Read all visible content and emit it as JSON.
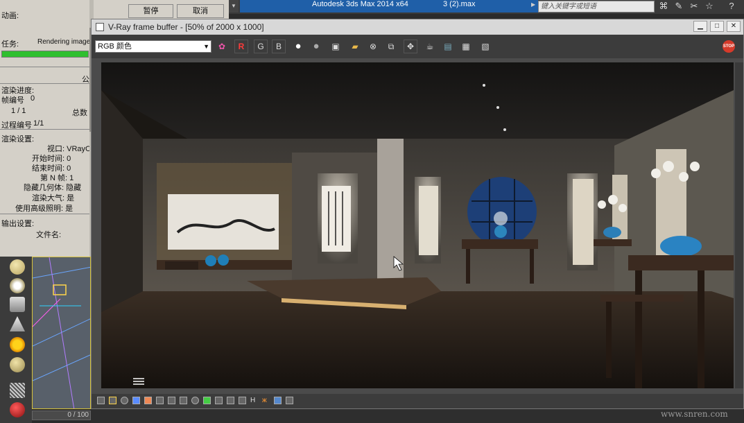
{
  "topbar": {
    "app_title": "Autodesk 3ds Max  2014 x64",
    "file_title": "3 (2).max",
    "search_placeholder": "键入关键字或短语"
  },
  "render_panel": {
    "animation_label": "动画:",
    "pause_button": "暂停",
    "cancel_button": "取消",
    "task_label": "任务:",
    "task_value": "Rendering image",
    "progress_fraction": 1.0,
    "common_tab": "公",
    "progress_heading": "渲染进度:",
    "frame_label": "帧编号",
    "frame_value": "0",
    "frame_count": "1 / 1",
    "total_label": "总数",
    "pass_label": "过程编号",
    "pass_value": "1/1",
    "settings_heading": "渲染设置:",
    "viewport_label": "视口: VRayC",
    "start_time": "开始时间: 0",
    "end_time": "结束时间: 0",
    "nth_frame": "第 N 帧: 1",
    "hidden_geo": "隐藏几何体: 隐藏",
    "render_atmo": "渲染大气: 是",
    "adv_light": "使用高级照明: 是",
    "output_heading": "输出设置:",
    "filename_label": "文件名:"
  },
  "viewport": {
    "frame_slider": "0 / 100"
  },
  "vfb": {
    "title": "V-Ray frame buffer - [50% of 2000 x 1000]",
    "channel_select": "RGB 颜色",
    "r_label": "R",
    "g_label": "G",
    "b_label": "B",
    "stop_label": "STOP"
  },
  "watermark": "www.snren.com",
  "colors": {
    "title_blue": "#1f5fa8",
    "progress_green": "#2fbf2f",
    "stop_red": "#d63a2a"
  }
}
